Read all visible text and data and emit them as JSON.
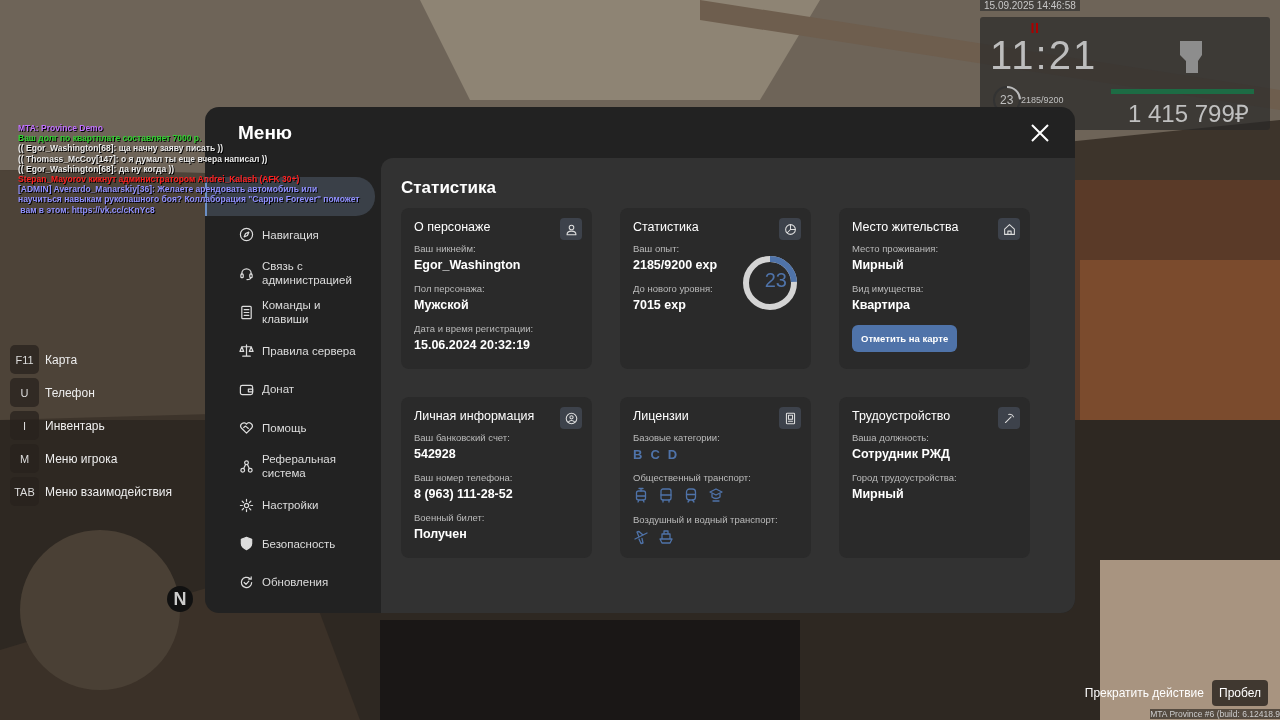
{
  "chat": [
    {
      "text": "MTA: Province Demo",
      "color": "#c070ff"
    },
    {
      "text": "Ваш долг по квартплате составляет 7000 р.",
      "color": "#30d030"
    },
    {
      "text": "(( Egor_Washington[68]: ща начну заяву писать ))",
      "color": "#e8e8e8"
    },
    {
      "text": "(( Thomass_McCoy[147]: о я думал ты еще вчера написал ))",
      "color": "#e8e8e8"
    },
    {
      "text": "(( Egor_Washington[68]: да ну когда ))",
      "color": "#e8e8e8"
    },
    {
      "text": "Stepan_Mayorov кикнут администратором Andrei_Kalash (AFK 30+)",
      "color": "#ff2020"
    },
    {
      "text": "[ADMIN] Averardo_Manarskiy[36]: Желаете арендовать автомобиль или",
      "color": "#9090ff"
    },
    {
      "text": "научиться навыкам рукопашного боя? Коллаборация \"Cappne Forever\" поможет",
      "color": "#9090ff"
    },
    {
      "text": " вам в этом: https://vk.cc/cKnYc8",
      "color": "#9090ff"
    }
  ],
  "hud": {
    "date": "15.09.2025 14:46:58",
    "time": "11:21",
    "level": "23",
    "exp": "2185/9200",
    "exp_ring": {
      "level": 0.24
    },
    "health": {
      "level": 1
    },
    "money": "1 415 799₽"
  },
  "hotkeys": [
    {
      "key": "F11",
      "label": "Карта"
    },
    {
      "key": "U",
      "label": "Телефон"
    },
    {
      "key": "I",
      "label": "Инвентарь"
    },
    {
      "key": "M",
      "label": "Меню игрока"
    },
    {
      "key": "TAB",
      "label": "Меню взаимодействия"
    }
  ],
  "minimap": {
    "north": "N"
  },
  "action_hint": {
    "label": "Прекратить действие",
    "key": "Пробел"
  },
  "build": "MTA Province #6 (build: 6.12418.9",
  "menu": {
    "title": "Меню",
    "sidebar": [
      {
        "selected": true
      },
      {
        "label": "Навигация",
        "selected": false
      },
      {
        "label": "Связь с администрацией",
        "selected": false
      },
      {
        "label": "Команды и клавиши",
        "selected": false
      },
      {
        "label": "Правила сервера",
        "selected": false
      },
      {
        "label": "Донат",
        "selected": false
      },
      {
        "label": "Помощь",
        "selected": false
      },
      {
        "label": "Реферальная система",
        "selected": false
      },
      {
        "label": "Настройки",
        "selected": false
      },
      {
        "label": "Безопасность",
        "selected": false
      },
      {
        "label": "Обновления",
        "selected": false
      }
    ],
    "heading": "Статистика",
    "cards": [
      {
        "kind": "info",
        "title": "О персонаже",
        "fields": [
          {
            "label": "Ваш никнейм:",
            "value": "Egor_Washington"
          },
          {
            "label": "Пол персонажа:",
            "value": "Мужской"
          },
          {
            "label": "Дата и время регистрации:",
            "value": "15.06.2024 20:32:19"
          }
        ]
      },
      {
        "kind": "stats",
        "title": "Статистика",
        "fields": [
          {
            "label": "Ваш опыт:",
            "value": "2185/9200 exp"
          },
          {
            "label": "До нового уровня:",
            "value": "7015 exp"
          }
        ],
        "ring": {
          "value": "23",
          "level": 0.24
        }
      },
      {
        "kind": "info",
        "title": "Место жительства",
        "fields": [
          {
            "label": "Место проживания:",
            "value": "Мирный"
          },
          {
            "label": "Вид имущества:",
            "value": "Квартира"
          }
        ],
        "button": "Отметить на карте"
      },
      {
        "kind": "info",
        "title": "Личная информация",
        "fields": [
          {
            "label": "Ваш банковский счет:",
            "value": "542928"
          },
          {
            "label": "Ваш номер телефона:",
            "value": "8 (963) 111-28-52"
          },
          {
            "label": "Военный билет:",
            "value": "Получен"
          }
        ]
      },
      {
        "kind": "licenses",
        "title": "Лицензии",
        "categories_label": "Базовые категории:",
        "categories": [
          "B",
          "C",
          "D"
        ],
        "groups": [
          {
            "label": "Общественный транспорт:"
          },
          {
            "label": "Воздушный и водный транспорт:"
          }
        ]
      },
      {
        "kind": "info",
        "title": "Трудоустройство",
        "fields": [
          {
            "label": "Ваша должность:",
            "value": "Сотрудник РЖД"
          },
          {
            "label": "Город трудоустройства:",
            "value": "Мирный"
          }
        ]
      }
    ]
  }
}
